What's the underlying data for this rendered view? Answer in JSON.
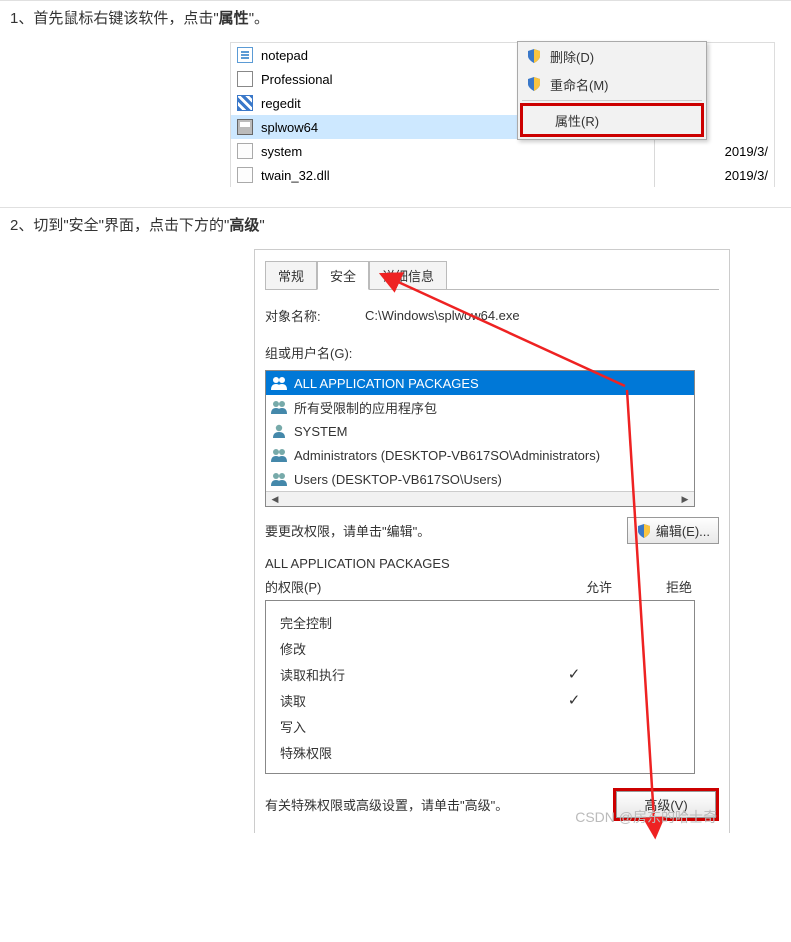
{
  "step1": {
    "text_before": "1、首先鼠标右键该软件，点击\"",
    "bold": "属性",
    "text_after": "\"。"
  },
  "explorer": {
    "files": [
      {
        "name": "notepad",
        "icon": "notepad"
      },
      {
        "name": "Professional",
        "icon": "prof"
      },
      {
        "name": "regedit",
        "icon": "reg"
      },
      {
        "name": "splwow64",
        "icon": "printer",
        "selected": true
      },
      {
        "name": "system",
        "icon": "sys"
      },
      {
        "name": "twain_32.dll",
        "icon": "dll"
      }
    ],
    "dates": [
      "",
      "",
      "",
      "",
      "2019/3/",
      "2019/3/"
    ],
    "context_menu": {
      "delete": "删除(D)",
      "rename": "重命名(M)",
      "properties": "属性(R)"
    }
  },
  "step2": {
    "text": "2、切到\"安全\"界面，点击下方的\"",
    "bold": "高级",
    "text_after": "\""
  },
  "dialog": {
    "tabs": {
      "general": "常规",
      "security": "安全",
      "details": "详细信息"
    },
    "object_label": "对象名称:",
    "object_value": "C:\\Windows\\splwow64.exe",
    "groups_label": "组或用户名(G):",
    "groups": [
      "ALL APPLICATION PACKAGES",
      "所有受限制的应用程序包",
      "SYSTEM",
      "Administrators (DESKTOP-VB617SO\\Administrators)",
      "Users (DESKTOP-VB617SO\\Users)"
    ],
    "edit_hint": "要更改权限，请单击\"编辑\"。",
    "edit_button": "编辑(E)...",
    "perm_title_1": "ALL APPLICATION PACKAGES",
    "perm_title_2": "的权限(P)",
    "col_allow": "允许",
    "col_deny": "拒绝",
    "perms": [
      {
        "label": "完全控制",
        "allow": false
      },
      {
        "label": "修改",
        "allow": false
      },
      {
        "label": "读取和执行",
        "allow": true
      },
      {
        "label": "读取",
        "allow": true
      },
      {
        "label": "写入",
        "allow": false
      },
      {
        "label": "特殊权限",
        "allow": false
      }
    ],
    "adv_hint": "有关特殊权限或高级设置，请单击\"高级\"。",
    "adv_button": "高级(V)"
  },
  "watermark": "CSDN @房东的哈士奇"
}
